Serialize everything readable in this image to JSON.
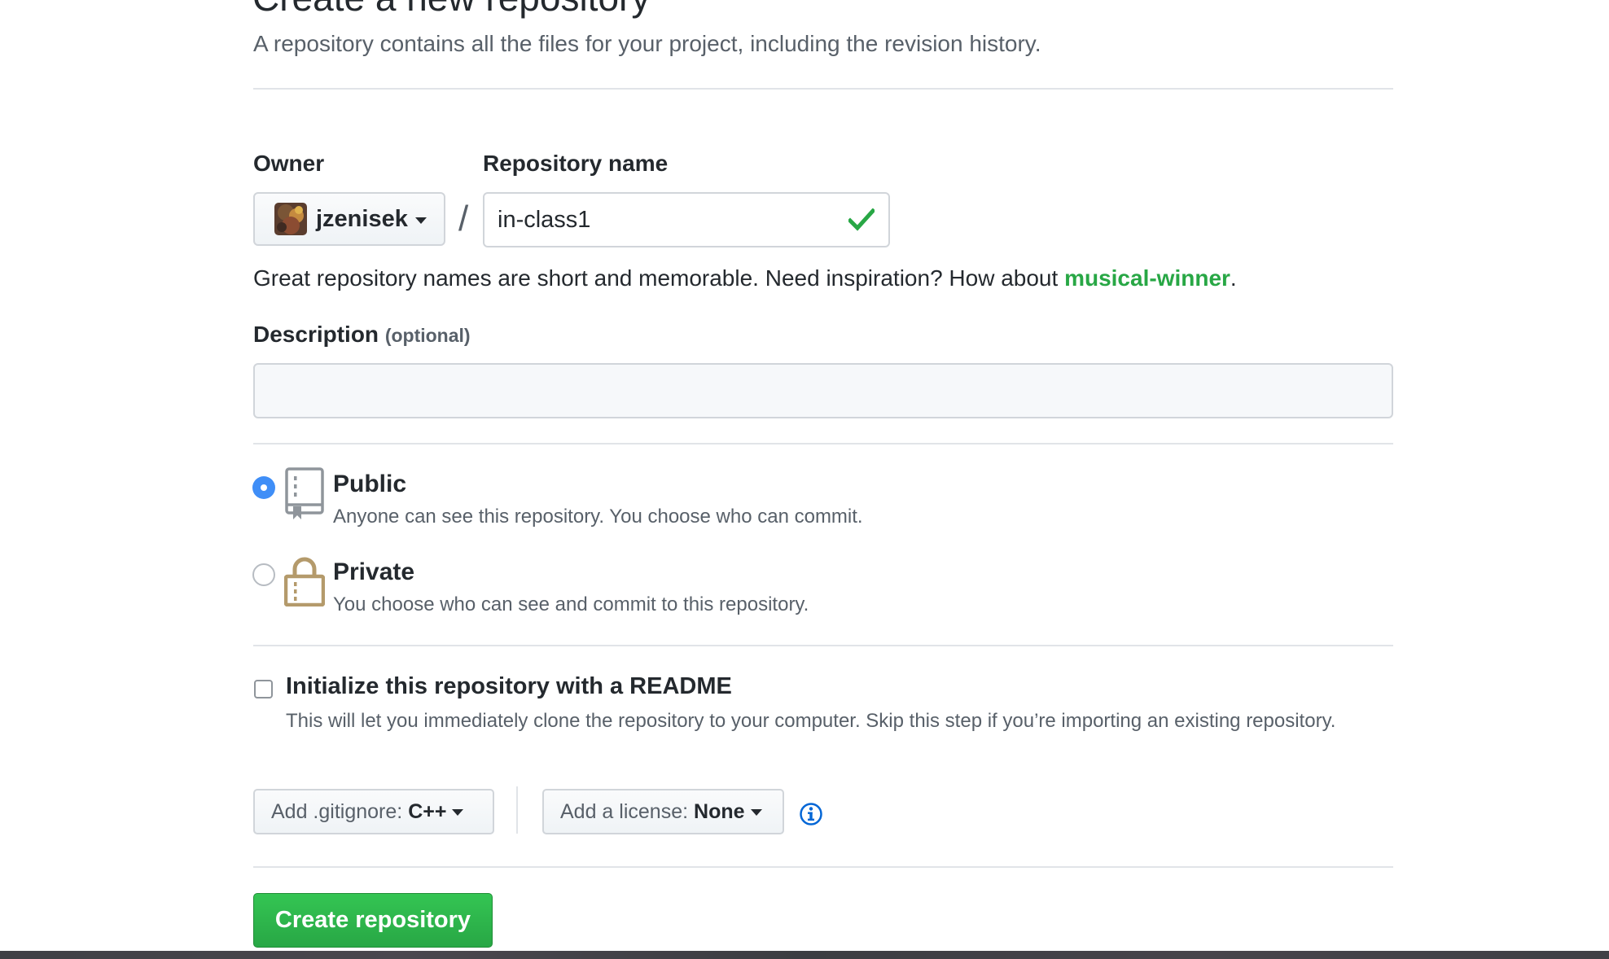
{
  "header": {
    "title": "Create a new repository",
    "subtitle": "A repository contains all the files for your project, including the revision history."
  },
  "owner": {
    "label": "Owner",
    "name": "jzenisek"
  },
  "separator": "/",
  "repository_name": {
    "label": "Repository name",
    "value": "in-class1",
    "valid": true
  },
  "name_hint": {
    "text": "Great repository names are short and memorable. Need inspiration? How about ",
    "suggestion": "musical-winner",
    "suffix": "."
  },
  "description": {
    "label": "Description",
    "optional_label": "(optional)",
    "value": "",
    "placeholder": ""
  },
  "visibility": {
    "selected": "public",
    "options": [
      {
        "key": "public",
        "label": "Public",
        "description": "Anyone can see this repository. You choose who can commit.",
        "icon": "repo-book-icon"
      },
      {
        "key": "private",
        "label": "Private",
        "description": "You choose who can see and commit to this repository.",
        "icon": "lock-icon"
      }
    ]
  },
  "readme": {
    "label": "Initialize this repository with a README",
    "description": "This will let you immediately clone the repository to your computer. Skip this step if you’re importing an existing repository.",
    "checked": false
  },
  "gitignore": {
    "label": "Add .gitignore:",
    "value": "C++"
  },
  "license": {
    "label": "Add a license:",
    "value": "None"
  },
  "submit": {
    "label": "Create repository"
  },
  "colors": {
    "accent_blue": "#3f8ef7",
    "success_green": "#28a745",
    "suggestion_green": "#2f7a1f",
    "lock_tan": "#b49a6b"
  }
}
